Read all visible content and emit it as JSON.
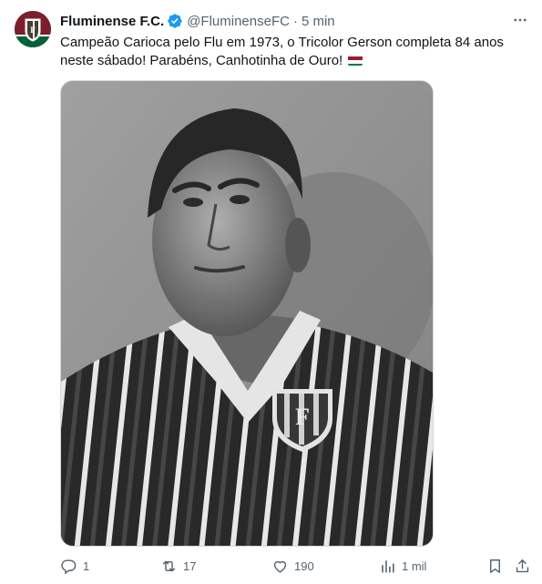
{
  "author": {
    "name": "Fluminense F.C.",
    "handle": "@FluminenseFC",
    "separator": "·",
    "time": "5 min"
  },
  "tweet": {
    "text": "Campeão Carioca pelo Flu em 1973, o Tricolor Gerson completa 84 anos neste sábado! Parabéns, Canhotinha de Ouro!",
    "flag_icon": "tricolor-flag-emoji"
  },
  "actions": {
    "replies": "1",
    "retweets": "17",
    "likes": "190",
    "views": "1 mil"
  },
  "colors": {
    "text": "#0f1419",
    "secondary": "#536471",
    "verified": "#1d9bf0",
    "club_garnet": "#7a1f2b",
    "club_green": "#00613c"
  },
  "icons": [
    "verified-badge-icon",
    "more-icon",
    "reply-icon",
    "retweet-icon",
    "like-icon",
    "views-icon",
    "bookmark-icon",
    "share-icon"
  ]
}
